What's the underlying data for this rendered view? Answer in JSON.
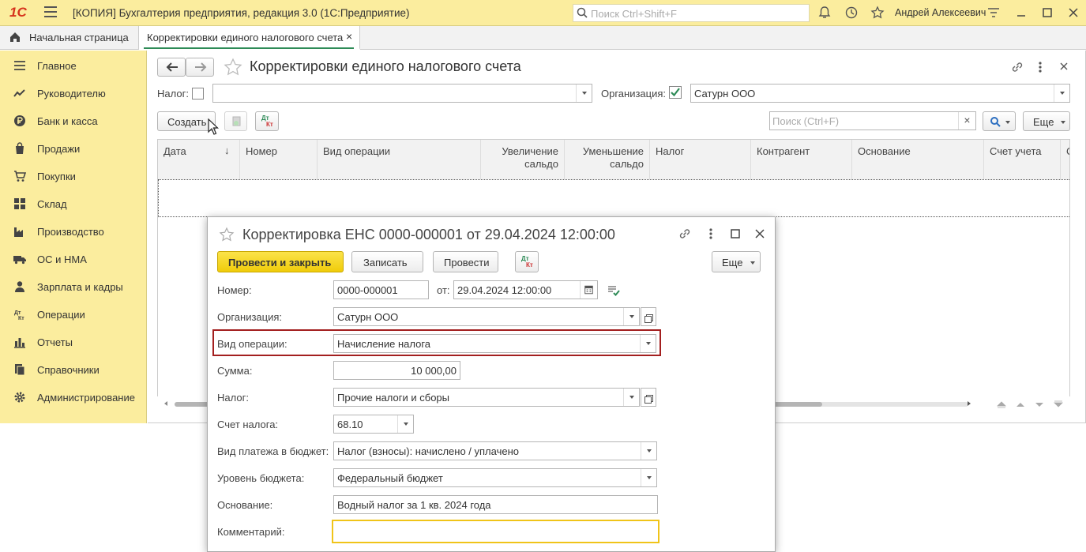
{
  "app": {
    "logo": "1С",
    "title": "[КОПИЯ] Бухгалтерия предприятия, редакция 3.0  (1С:Предприятие)",
    "search_placeholder": "Поиск Ctrl+Shift+F",
    "user": "Андрей Алексеевич"
  },
  "tabs": {
    "home": "Начальная страница",
    "active": "Корректировки единого налогового счета",
    "close": "×"
  },
  "sidebar": {
    "items": [
      {
        "label": "Главное",
        "icon": "menu-lines-icon"
      },
      {
        "label": "Руководителю",
        "icon": "trend-chart-icon"
      },
      {
        "label": "Банк и касса",
        "icon": "ruble-coin-icon"
      },
      {
        "label": "Продажи",
        "icon": "shopping-bag-icon"
      },
      {
        "label": "Покупки",
        "icon": "shopping-cart-icon"
      },
      {
        "label": "Склад",
        "icon": "warehouse-grid-icon"
      },
      {
        "label": "Производство",
        "icon": "factory-icon"
      },
      {
        "label": "ОС и НМА",
        "icon": "truck-icon"
      },
      {
        "label": "Зарплата и кадры",
        "icon": "person-icon"
      },
      {
        "label": "Операции",
        "icon": "dt-kt-icon"
      },
      {
        "label": "Отчеты",
        "icon": "bar-chart-icon"
      },
      {
        "label": "Справочники",
        "icon": "books-icon"
      },
      {
        "label": "Администрирование",
        "icon": "gear-icon"
      }
    ]
  },
  "list_form": {
    "title": "Корректировки единого налогового счета",
    "nalog_label": "Налог:",
    "org_label": "Организация:",
    "org_value": "Сатурн ООО",
    "create_label": "Создать",
    "dtkt_top": "Дт",
    "dtkt_bottom": "Кт",
    "search_placeholder": "Поиск (Ctrl+F)",
    "clear": "×",
    "more_label": "Еще",
    "columns": [
      "Дата",
      "Номер",
      "Вид операции",
      "Увеличение сальдо",
      "Уменьшение сальдо",
      "Налог",
      "Контрагент",
      "Основание",
      "Счет учета",
      "С"
    ]
  },
  "dialog": {
    "title": "Корректировка ЕНС 0000-000001 от 29.04.2024 12:00:00",
    "post_close": "Провести и закрыть",
    "save": "Записать",
    "post": "Провести",
    "more": "Еще",
    "fields": {
      "number_label": "Номер:",
      "number_value": "0000-000001",
      "from_label": "от:",
      "date_value": "29.04.2024 12:00:00",
      "org_label": "Организация:",
      "org_value": "Сатурн ООО",
      "op_label": "Вид операции:",
      "op_value": "Начисление налога",
      "sum_label": "Сумма:",
      "sum_value": "10 000,00",
      "tax_label": "Налог:",
      "tax_value": "Прочие налоги и сборы",
      "account_label": "Счет налога:",
      "account_value": "68.10",
      "payment_label": "Вид платежа в бюджет:",
      "payment_value": "Налог (взносы): начислено / уплачено",
      "level_label": "Уровень бюджета:",
      "level_value": "Федеральный бюджет",
      "basis_label": "Основание:",
      "basis_value": "Водный налог за 1 кв. 2024 года",
      "comment_label": "Комментарий:",
      "comment_value": ""
    }
  },
  "colors": {
    "chrome_yellow": "#fbed9e",
    "primary_button": "#f5d30e",
    "highlight_border": "#a31f1f",
    "focus_border": "#f0c419",
    "check_green": "#2e8b57"
  }
}
